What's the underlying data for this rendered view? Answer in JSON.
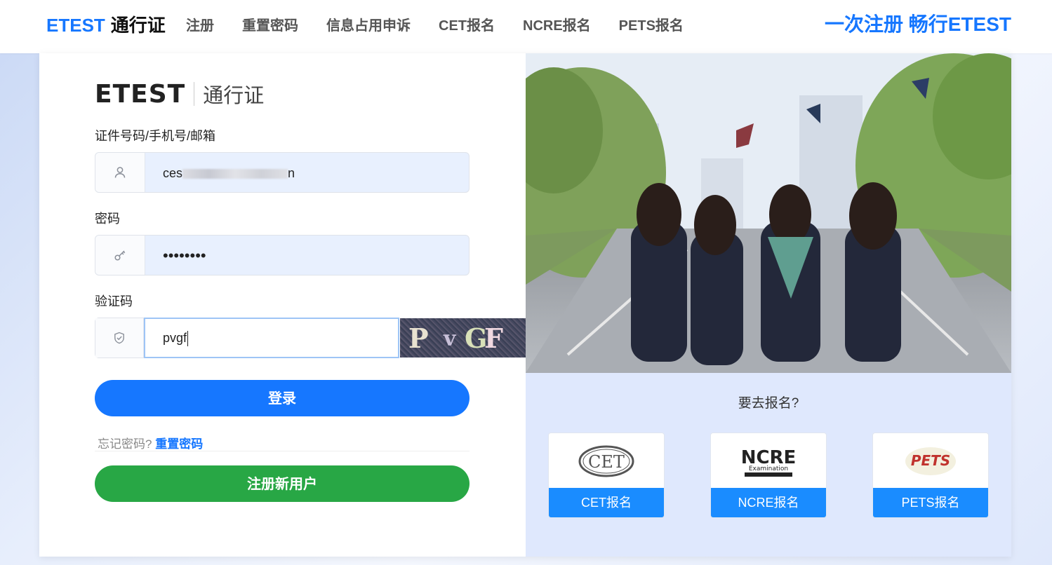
{
  "header": {
    "brand_en": "ETEST",
    "brand_zh": "通行证",
    "nav": [
      "注册",
      "重置密码",
      "信息占用申诉",
      "CET报名",
      "NCRE报名",
      "PETS报名"
    ],
    "slogan": "一次注册 畅行ETEST"
  },
  "login": {
    "logo_en": "ETEST",
    "logo_zh": "通行证",
    "account_label": "证件号码/手机号/邮箱",
    "account_value_prefix": "ces",
    "account_value_suffix": "n",
    "password_label": "密码",
    "password_value": "••••••••",
    "captcha_label": "验证码",
    "captcha_value": "pvgf",
    "captcha_image_text": [
      "P",
      "v",
      "G",
      "F"
    ],
    "login_button": "登录",
    "forgot_text": "忘记密码?",
    "forgot_link": "重置密码",
    "register_button": "注册新用户"
  },
  "promo": {
    "question": "要去报名?",
    "tiles": [
      {
        "logo": "CET",
        "label": "CET报名"
      },
      {
        "logo": "NCRE",
        "logo_sub": "Examination",
        "label": "NCRE报名"
      },
      {
        "logo": "PETS",
        "label": "PETS报名"
      }
    ]
  },
  "colors": {
    "primary": "#1677ff",
    "success": "#28a745",
    "tile_button": "#1a8cff"
  }
}
